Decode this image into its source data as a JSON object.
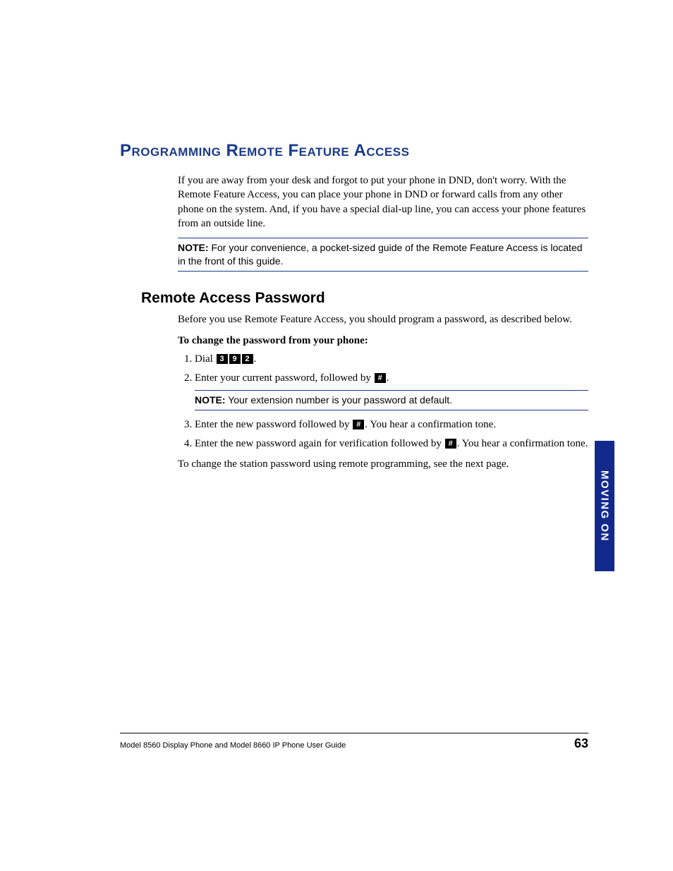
{
  "heading1": "Programming Remote Feature Access",
  "intro": "If you are away from your desk and forgot to put your phone in DND, don't worry. With the Remote Feature Access, you can place your phone in DND or forward calls from any other phone on the system. And, if you have a special dial-up line, you can access your phone features from an outside line.",
  "note1_label": "NOTE:",
  "note1_text": " For your convenience, a pocket-sized guide of the Remote Feature Access is located in the front of this guide.",
  "heading2": "Remote Access Password",
  "para2": "Before you use Remote Feature Access, you should program a password, as described below.",
  "instr_heading": "To change the password from your phone:",
  "step1_a": "Dial ",
  "key_3": "3",
  "key_9": "9",
  "key_2": "2",
  "step1_end": ".",
  "step2_a": "Enter your current password, followed by ",
  "key_hash": "#",
  "step2_end": ".",
  "note2_label": "NOTE:",
  "note2_text": " Your extension number is your password at default.",
  "step3_a": "Enter the new password followed by ",
  "step3_b": ". You hear a confirmation tone.",
  "step4_a": "Enter the new password again for verification followed by ",
  "step4_b": ". You hear a confirmation tone.",
  "closing": "To change the station password using remote programming, see the next page.",
  "side_tab": "MOVING ON",
  "footer_text": "Model 8560 Display Phone and Model 8660 IP Phone User Guide",
  "page_number": "63"
}
